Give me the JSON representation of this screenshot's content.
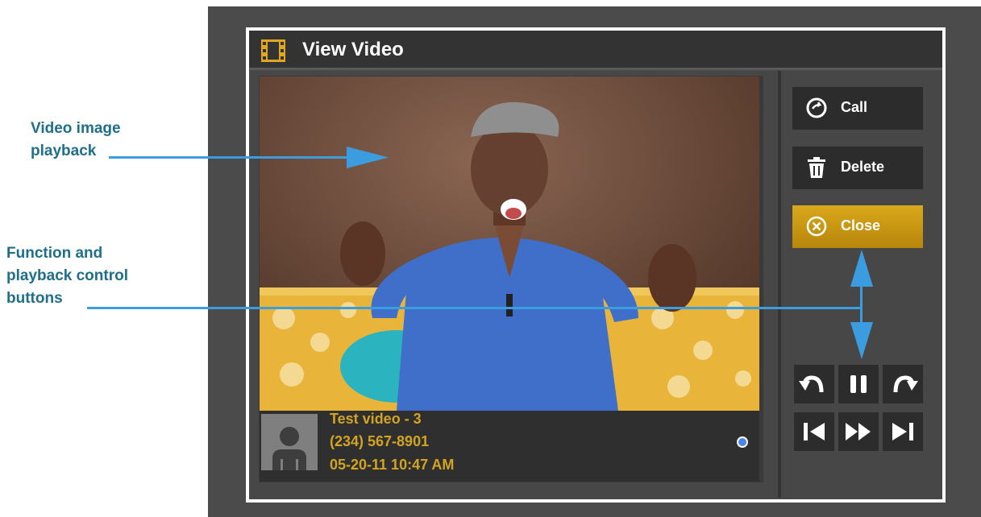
{
  "annotations": {
    "video_label_line1": "Video image",
    "video_label_line2": "playback",
    "controls_label_line1": "Function and",
    "controls_label_line2": "playback control",
    "controls_label_line3": "buttons"
  },
  "dialog": {
    "title": "View Video",
    "title_icon": "film-icon"
  },
  "video_info": {
    "name": "Test video - 3",
    "phone": "(234) 567-8901",
    "datetime": "05-20-11 10:47 AM"
  },
  "actions": {
    "call_label": "Call",
    "delete_label": "Delete",
    "close_label": "Close"
  },
  "playback_controls": [
    "rewind-icon",
    "pause-icon",
    "forward-icon",
    "skip-previous-icon",
    "fast-forward-icon",
    "skip-next-icon"
  ],
  "colors": {
    "annotation": "#1f6e8c",
    "accent": "#d2a422",
    "arrow": "#3b9de0",
    "status_dot": "#4a86e8"
  }
}
